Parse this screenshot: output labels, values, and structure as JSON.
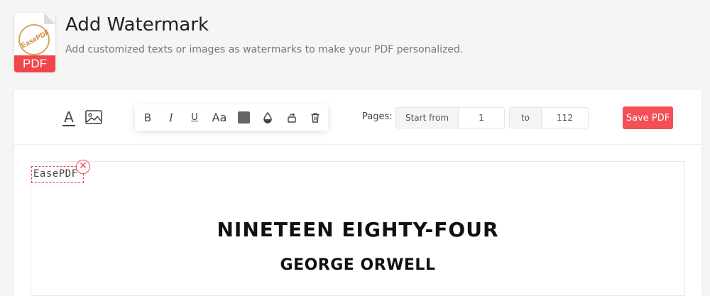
{
  "header": {
    "title": "Add Watermark",
    "subtitle": "Add customized texts or images as watermarks to make your PDF personalized.",
    "logo": {
      "stamp_text": "EasePDF",
      "badge_text": "PDF",
      "badge_color": "#f0464c"
    }
  },
  "toolbar": {
    "tools": [
      {
        "name": "text-watermark",
        "icon": "text-icon",
        "glyph": "A"
      },
      {
        "name": "image-watermark",
        "icon": "image-icon"
      }
    ],
    "format": {
      "bold": "B",
      "italic": "I",
      "underline": "U",
      "font_size": "Aa",
      "color": "#666666",
      "opacity_icon": "opacity-icon",
      "rotate_icon": "rotate-icon",
      "delete_icon": "trash-icon"
    },
    "pages": {
      "label": "Pages:",
      "start_prefix": "Start from",
      "start_value": "1",
      "end_prefix": "to",
      "end_value": "112"
    },
    "save_label": "Save PDF",
    "accent": "#f44f57"
  },
  "document": {
    "watermark_text": "EasePDF",
    "close_glyph": "✕",
    "book_title": "NINETEEN EIGHTY-FOUR",
    "book_author": "GEORGE ORWELL"
  }
}
